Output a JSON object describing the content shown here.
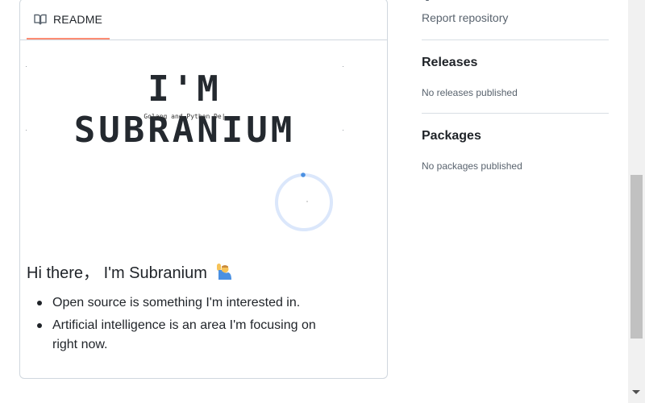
{
  "readme": {
    "tab_label": "README",
    "tab_icon": "book-icon",
    "banner_title": "I'M SUBRANIUM",
    "banner_subtitle": "Golang and Python De|",
    "heading": "Hi there， I'm Subranium",
    "heading_emoji": "man-raising-hand-emoji",
    "list": [
      "Open source is something I'm interested in.",
      "Artificial intelligence is an area I'm focusing on right now."
    ]
  },
  "sidebar": {
    "report_link": "Report repository",
    "releases": {
      "title": "Releases",
      "empty_text": "No releases published"
    },
    "packages": {
      "title": "Packages",
      "empty_text": "No packages published"
    }
  },
  "colors": {
    "tab_underline": "#fd8c73",
    "spinner_ring": "#dbe7fb",
    "spinner_dot": "#4a90e2",
    "muted_text": "#59636e"
  }
}
